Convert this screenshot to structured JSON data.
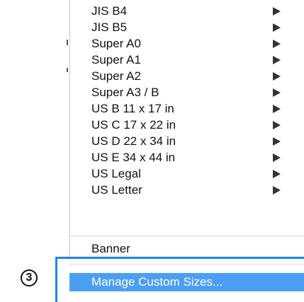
{
  "menu": {
    "items": [
      {
        "label": "JIS B4",
        "submenu": true
      },
      {
        "label": "JIS B5",
        "submenu": true
      },
      {
        "label": "Super A0",
        "submenu": true
      },
      {
        "label": "Super A1",
        "submenu": true
      },
      {
        "label": "Super A2",
        "submenu": true
      },
      {
        "label": "Super A3 / B",
        "submenu": true
      },
      {
        "label": "US B 11 x 17 in",
        "submenu": true
      },
      {
        "label": "US C 17 x 22 in",
        "submenu": true
      },
      {
        "label": "US D 22 x 34 in",
        "submenu": true
      },
      {
        "label": "US E 34 x 44 in",
        "submenu": true
      },
      {
        "label": "US Legal",
        "submenu": true
      },
      {
        "label": "US Letter",
        "submenu": true
      }
    ],
    "banner_label": "Banner",
    "manage_label": "Manage Custom Sizes..."
  },
  "annotation": {
    "step_number": "3"
  },
  "colors": {
    "highlight_frame": "#1e88e5",
    "selected_background": "#4a9ff5",
    "selected_text": "#ffffff"
  }
}
